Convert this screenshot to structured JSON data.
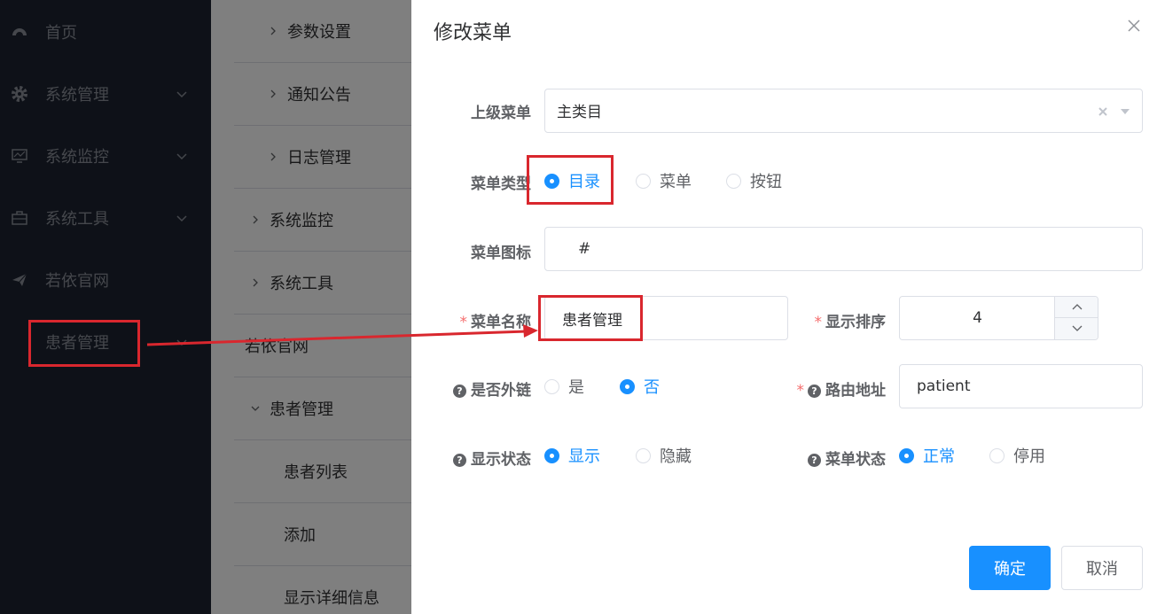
{
  "sidebar": {
    "items": [
      {
        "label": "首页",
        "icon": "dashboard-icon",
        "has_chevron": false
      },
      {
        "label": "系统管理",
        "icon": "gear-icon",
        "has_chevron": true
      },
      {
        "label": "系统监控",
        "icon": "monitor-icon",
        "has_chevron": true
      },
      {
        "label": "系统工具",
        "icon": "toolbox-icon",
        "has_chevron": true
      },
      {
        "label": "若依官网",
        "icon": "paper-plane-icon",
        "has_chevron": false
      },
      {
        "label": "患者管理",
        "icon": "",
        "has_chevron": true
      }
    ]
  },
  "tree": {
    "rows": [
      {
        "label": "参数设置",
        "arrow": "right"
      },
      {
        "label": "通知公告",
        "arrow": "right"
      },
      {
        "label": "日志管理",
        "arrow": "right"
      },
      {
        "label": "系统监控",
        "arrow": "right"
      },
      {
        "label": "系统工具",
        "arrow": "right"
      },
      {
        "label": "若依官网",
        "arrow": ""
      },
      {
        "label": "患者管理",
        "arrow": "down"
      },
      {
        "label": "患者列表",
        "arrow": ""
      },
      {
        "label": "添加",
        "arrow": ""
      },
      {
        "label": "显示详细信息",
        "arrow": ""
      }
    ]
  },
  "dialog": {
    "title": "修改菜单",
    "parent_menu": {
      "label": "上级菜单",
      "value": "主类目"
    },
    "menu_type": {
      "label": "菜单类型",
      "options": [
        "目录",
        "菜单",
        "按钮"
      ],
      "selected": "目录"
    },
    "menu_icon": {
      "label": "菜单图标",
      "value": "#"
    },
    "menu_name": {
      "label": "菜单名称",
      "required": "*",
      "value": "患者管理"
    },
    "order": {
      "label": "显示排序",
      "required": "*",
      "value": "4"
    },
    "is_frame": {
      "label": "是否外链",
      "options": [
        "是",
        "否"
      ],
      "selected": "否"
    },
    "route": {
      "label": "路由地址",
      "required": "*",
      "value": "patient"
    },
    "visible": {
      "label": "显示状态",
      "options": [
        "显示",
        "隐藏"
      ],
      "selected": "显示"
    },
    "status": {
      "label": "菜单状态",
      "options": [
        "正常",
        "停用"
      ],
      "selected": "正常"
    },
    "confirm_label": "确定",
    "cancel_label": "取消"
  },
  "colors": {
    "primary": "#1890ff",
    "sidebar_bg": "#1c2331",
    "annotation_red": "#d9272e"
  }
}
